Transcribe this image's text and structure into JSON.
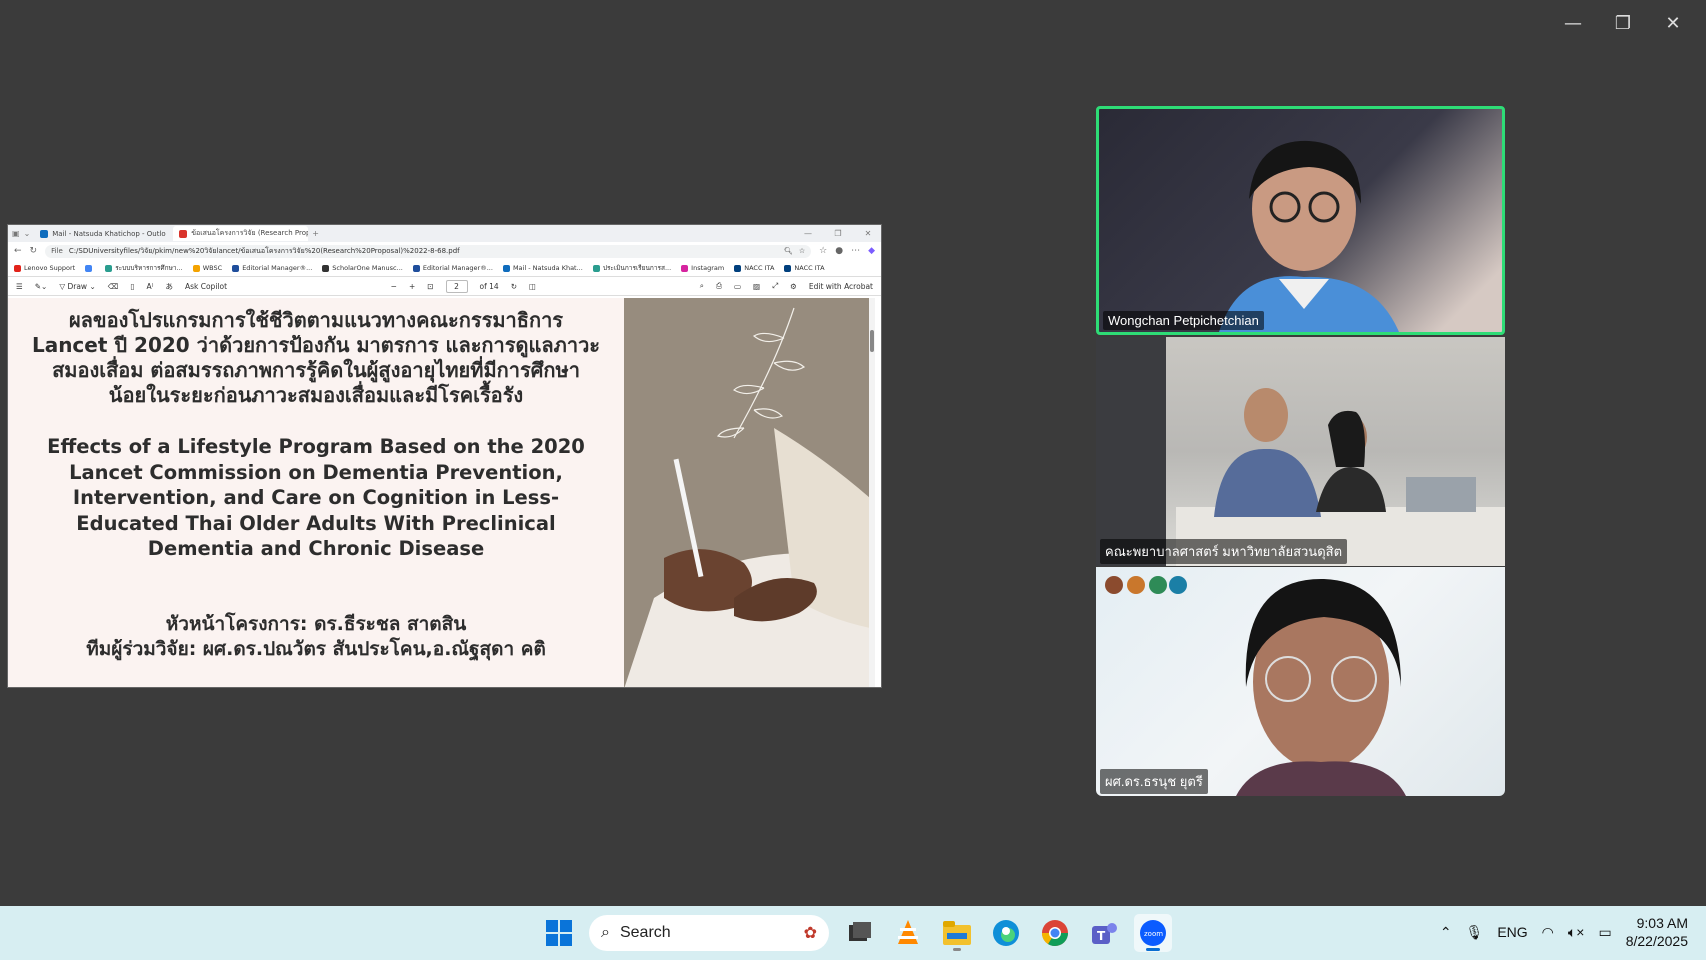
{
  "window_controls": {
    "minimize": "—",
    "restore": "❐",
    "close": "✕"
  },
  "browser": {
    "tabs": [
      {
        "label": "Mail - Natsuda Khatichop - Outlo",
        "color": "#0f6cbd",
        "active": false
      },
      {
        "label": "ข้อเสนอโครงการวิจัย (Research Propo",
        "color": "#d9342b",
        "active": true
      }
    ],
    "new_tab": "+",
    "address": {
      "scheme": "File",
      "url": "C:/SDUniversityfiles/วิจัย/pkim/new%20วิจัยlancet/ข้อเสนอโครงการวิจัย%20(Research%20Proposal)%2022-8-68.pdf"
    },
    "bookmarks": [
      {
        "label": "Lenovo Support",
        "color": "#e2231a"
      },
      {
        "label": "",
        "color": "#4285f4"
      },
      {
        "label": "ระบบบริหารการศึกษา...",
        "color": "#2a9d8f"
      },
      {
        "label": "WBSC",
        "color": "#f4a300"
      },
      {
        "label": "Editorial Manager®...",
        "color": "#1f4e9c"
      },
      {
        "label": "ScholarOne Manusc...",
        "color": "#333333"
      },
      {
        "label": "Editorial Manager®...",
        "color": "#1f4e9c"
      },
      {
        "label": "Mail - Natsuda Khat...",
        "color": "#0f6cbd"
      },
      {
        "label": "ประเมินการเรียนการส...",
        "color": "#2a9d8f"
      },
      {
        "label": "Instagram",
        "color": "#d6249f"
      },
      {
        "label": "NACC ITA",
        "color": "#003f7d"
      },
      {
        "label": "NACC ITA",
        "color": "#003f7d"
      }
    ],
    "pdf_toolbar": {
      "draw_label": "Draw",
      "ask_copilot": "Ask Copilot",
      "zoom_out": "−",
      "zoom_in": "+",
      "page_current": "2",
      "page_total": "of 14",
      "edit_acrobat": "Edit with Acrobat"
    },
    "slide": {
      "thai_title": [
        "ผลของโปรแกรมการใช้ชีวิตตามแนวทางคณะกรรมาธิการ",
        "Lancet ปี 2020 ว่าด้วยการป้องกัน มาตรการ และการดูแลภาวะ",
        "สมองเสื่อม ต่อสมรรถภาพการรู้คิดในผู้สูงอายุไทยที่มีการศึกษา",
        "น้อยในระยะก่อนภาวะสมองเสื่อมและมีโรคเรื้อรัง"
      ],
      "eng_title": [
        "Effects of a Lifestyle Program Based on the 2020",
        "Lancet Commission on Dementia Prevention,",
        "Intervention, and Care on Cognition in Less-",
        "Educated Thai Older Adults With Preclinical",
        "Dementia and Chronic Disease"
      ],
      "pi": "หัวหน้าโครงการ: ดร.ธีระชล สาตสิน",
      "team": "ทีมผู้ร่วมวิจัย: ผศ.ดร.ปณวัตร สันประโคน,อ.ณัฐสุดา คติ"
    }
  },
  "participants": [
    {
      "name": "Wongchan Petpichetchian",
      "speaking": true
    },
    {
      "name": "คณะพยาบาลศาสตร์ มหาวิทยาลัยสวนดุสิต",
      "speaking": false
    },
    {
      "name": "ผศ.ดร.ธรนุช ยุตรี",
      "speaking": false
    }
  ],
  "taskbar": {
    "search_label": "Search",
    "language": "ENG",
    "time": "9:03 AM",
    "date": "8/22/2025",
    "apps": [
      "start-icon",
      "task-view-icon",
      "vlc-icon",
      "file-explorer-icon",
      "edge-icon",
      "chrome-icon",
      "teams-icon",
      "zoom-icon"
    ]
  }
}
